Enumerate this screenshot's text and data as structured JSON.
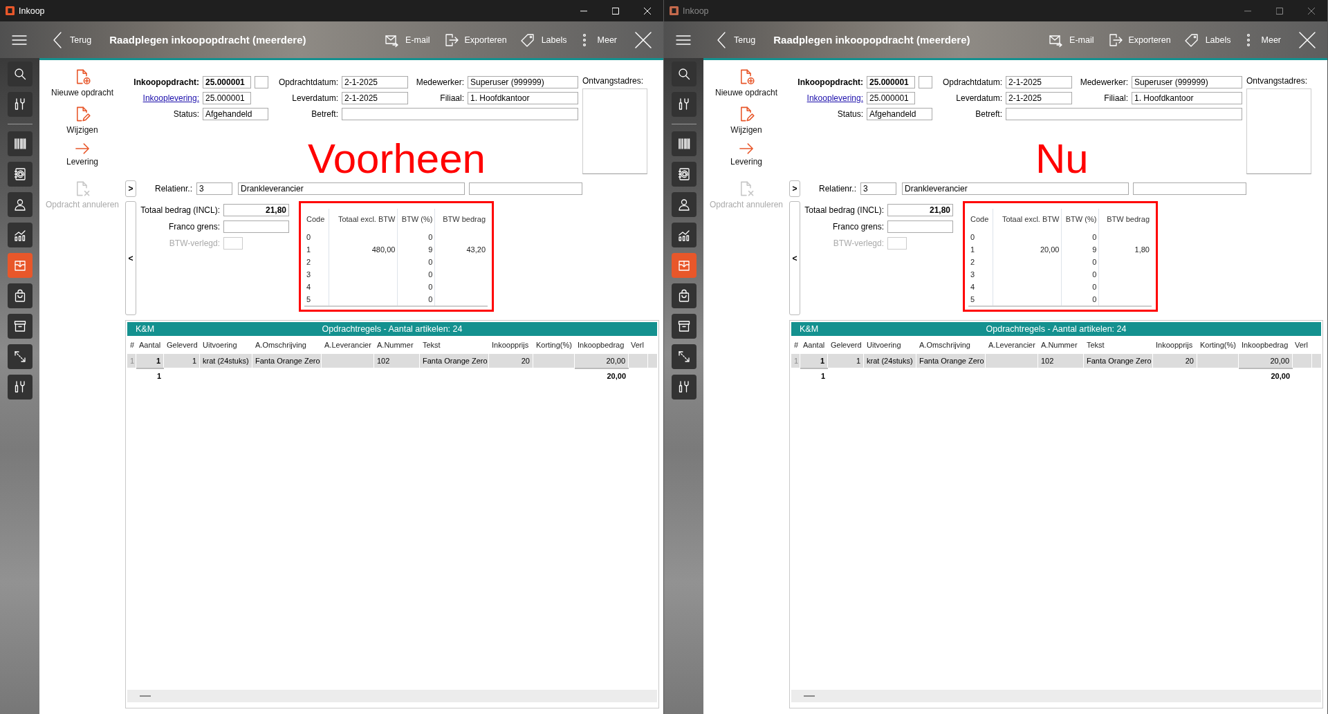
{
  "windows": [
    {
      "title": "Inkoop",
      "active": true,
      "toolbar": {
        "back": "Terug",
        "heading": "Raadplegen inkoopopdracht (meerdere)",
        "buttons": [
          {
            "label": "E-mail"
          },
          {
            "label": "Exporteren"
          },
          {
            "label": "Labels"
          },
          {
            "label": "Meer"
          }
        ]
      },
      "sidebar": {
        "items": [
          {
            "selected": false
          },
          {
            "selected": false
          },
          {
            "selected": false
          },
          {
            "selected": false
          },
          {
            "selected": false
          },
          {
            "selected": false
          },
          {
            "selected": true
          },
          {
            "selected": false
          },
          {
            "selected": false
          },
          {
            "selected": false
          },
          {
            "selected": false
          }
        ]
      },
      "actions": [
        {
          "label": "Nieuwe opdracht",
          "disabled": false
        },
        {
          "label": "Wijzigen",
          "disabled": false
        },
        {
          "label": "Levering",
          "disabled": false
        },
        {
          "label": "Opdracht annuleren",
          "disabled": true
        }
      ],
      "order": {
        "inkoopopdracht": {
          "label": "Inkoopopdracht:",
          "value": "25.000001"
        },
        "inkooplevering": {
          "label": "Inkooplevering:",
          "value": "25.000001"
        },
        "status": {
          "label": "Status:",
          "value": "Afgehandeld"
        },
        "opdrachtdatum": {
          "label": "Opdrachtdatum:",
          "value": "2-1-2025"
        },
        "leverdatum": {
          "label": "Leverdatum:",
          "value": "2-1-2025"
        },
        "betreft": {
          "label": "Betreft:"
        },
        "medewerker": {
          "label": "Medewerker:",
          "value": "Superuser (999999)"
        },
        "filiaal": {
          "label": "Filiaal:",
          "value": "1. Hoofdkantoor"
        },
        "ontvangstadres": {
          "label": "Ontvangstadres:"
        }
      },
      "relation": {
        "expand": ">",
        "label": "Relatienr.:",
        "number": "3",
        "name": "Drankleverancier"
      },
      "totals": {
        "collapse": "<",
        "total": {
          "label": "Totaal bedrag (INCL):",
          "value": "21,80"
        },
        "franco": {
          "label": "Franco grens:"
        },
        "reverse_charge": {
          "label": "BTW-verlegd:",
          "disabled": true
        }
      },
      "vat_table": {
        "highlighted": true,
        "columns": [
          "Code",
          "Totaal excl. BTW",
          "BTW (%)",
          "BTW bedrag"
        ],
        "rows": [
          [
            "0",
            "",
            "0",
            ""
          ],
          [
            "1",
            "480,00",
            "9",
            "43,20"
          ],
          [
            "2",
            "",
            "0",
            ""
          ],
          [
            "3",
            "",
            "0",
            ""
          ],
          [
            "4",
            "",
            "0",
            ""
          ],
          [
            "5",
            "",
            "0",
            ""
          ]
        ]
      },
      "annotation": "Voorheen",
      "grid": {
        "group": "K&M",
        "title": "Opdrachtregels - Aantal artikelen: 24",
        "columns": [
          "#",
          "Aantal",
          "Geleverd",
          "Uitvoering",
          "A.Omschrijving",
          "A.Leverancier",
          "A.Nummer",
          "Tekst",
          "Inkoopprijs",
          "Korting(%)",
          "Inkoopbedrag",
          "Verl"
        ],
        "rows": [
          {
            "selected": true,
            "cells": [
              "1",
              "1",
              "1",
              "krat (24stuks)",
              "Fanta Orange Zero",
              "",
              "102",
              "Fanta Orange Zero",
              "20",
              "",
              "20,00",
              ""
            ]
          }
        ],
        "totals": {
          "aantal": "1",
          "inkoopbedrag": "20,00"
        }
      }
    },
    {
      "title": "Inkoop",
      "active": false,
      "toolbar": {
        "back": "Terug",
        "heading": "Raadplegen inkoopopdracht (meerdere)",
        "buttons": [
          {
            "label": "E-mail"
          },
          {
            "label": "Exporteren"
          },
          {
            "label": "Labels"
          },
          {
            "label": "Meer"
          }
        ]
      },
      "sidebar": {
        "items": [
          {
            "selected": false
          },
          {
            "selected": false
          },
          {
            "selected": false
          },
          {
            "selected": false
          },
          {
            "selected": false
          },
          {
            "selected": false
          },
          {
            "selected": true
          },
          {
            "selected": false
          },
          {
            "selected": false
          },
          {
            "selected": false
          },
          {
            "selected": false
          }
        ]
      },
      "actions": [
        {
          "label": "Nieuwe opdracht",
          "disabled": false
        },
        {
          "label": "Wijzigen",
          "disabled": false
        },
        {
          "label": "Levering",
          "disabled": false
        },
        {
          "label": "Opdracht annuleren",
          "disabled": true
        }
      ],
      "order": {
        "inkoopopdracht": {
          "label": "Inkoopopdracht:",
          "value": "25.000001"
        },
        "inkooplevering": {
          "label": "Inkooplevering:",
          "value": "25.000001"
        },
        "status": {
          "label": "Status:",
          "value": "Afgehandeld"
        },
        "opdrachtdatum": {
          "label": "Opdrachtdatum:",
          "value": "2-1-2025"
        },
        "leverdatum": {
          "label": "Leverdatum:",
          "value": "2-1-2025"
        },
        "betreft": {
          "label": "Betreft:"
        },
        "medewerker": {
          "label": "Medewerker:",
          "value": "Superuser (999999)"
        },
        "filiaal": {
          "label": "Filiaal:",
          "value": "1. Hoofdkantoor"
        },
        "ontvangstadres": {
          "label": "Ontvangstadres:"
        }
      },
      "relation": {
        "expand": ">",
        "label": "Relatienr.:",
        "number": "3",
        "name": "Drankleverancier"
      },
      "totals": {
        "collapse": "<",
        "total": {
          "label": "Totaal bedrag (INCL):",
          "value": "21,80"
        },
        "franco": {
          "label": "Franco grens:"
        },
        "reverse_charge": {
          "label": "BTW-verlegd:",
          "disabled": true
        }
      },
      "vat_table": {
        "highlighted": true,
        "columns": [
          "Code",
          "Totaal excl. BTW",
          "BTW (%)",
          "BTW bedrag"
        ],
        "rows": [
          [
            "0",
            "",
            "0",
            ""
          ],
          [
            "1",
            "20,00",
            "9",
            "1,80"
          ],
          [
            "2",
            "",
            "0",
            ""
          ],
          [
            "3",
            "",
            "0",
            ""
          ],
          [
            "4",
            "",
            "0",
            ""
          ],
          [
            "5",
            "",
            "0",
            ""
          ]
        ]
      },
      "annotation": "Nu",
      "grid": {
        "group": "K&M",
        "title": "Opdrachtregels - Aantal artikelen: 24",
        "columns": [
          "#",
          "Aantal",
          "Geleverd",
          "Uitvoering",
          "A.Omschrijving",
          "A.Leverancier",
          "A.Nummer",
          "Tekst",
          "Inkoopprijs",
          "Korting(%)",
          "Inkoopbedrag",
          "Verl"
        ],
        "rows": [
          {
            "selected": true,
            "cells": [
              "1",
              "1",
              "1",
              "krat (24stuks)",
              "Fanta Orange Zero",
              "",
              "102",
              "Fanta Orange Zero",
              "20",
              "",
              "20,00",
              ""
            ]
          }
        ],
        "totals": {
          "aantal": "1",
          "inkoopbedrag": "20,00"
        }
      }
    }
  ]
}
